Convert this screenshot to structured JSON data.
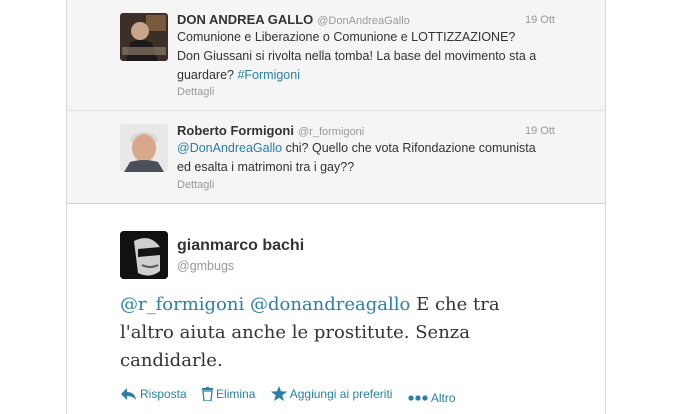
{
  "replies": [
    {
      "name": "DON ANDREA GALLO",
      "handle": "@DonAndreaGallo",
      "time": "19 Ott",
      "text_plain": "Comunione e Liberazione o Comunione e LOTTIZZAZIONE?Don Giussani si rivolta nella tomba! La base del movimento sta a guardare? ",
      "hashtag": "#Formigoni",
      "details": "Dettagli"
    },
    {
      "name": "Roberto Formigoni",
      "handle": "@r_formigoni",
      "time": "19 Ott",
      "mention": "@DonAndreaGallo",
      "text_plain": " chi? Quello che vota Rifondazione comunista ed esalta i matrimoni tra i gay??",
      "details": "Dettagli"
    }
  ],
  "tweet": {
    "name": "gianmarco bachi",
    "handle": "@gmbugs",
    "mention1": "@r_formigoni",
    "mention2": "@donandreagallo",
    "text": " E che tra l'altro aiuta anche le prostitute. Senza candidarle."
  },
  "actions": {
    "reply": "Risposta",
    "delete": "Elimina",
    "favorite": "Aggiungi ai preferiti",
    "more": "Altro",
    "icons": [
      "reply-icon",
      "trash-icon",
      "star-icon",
      "more-icon"
    ]
  },
  "colors": {
    "link": "#2a7fa6",
    "muted": "#999999",
    "text": "#333333"
  }
}
